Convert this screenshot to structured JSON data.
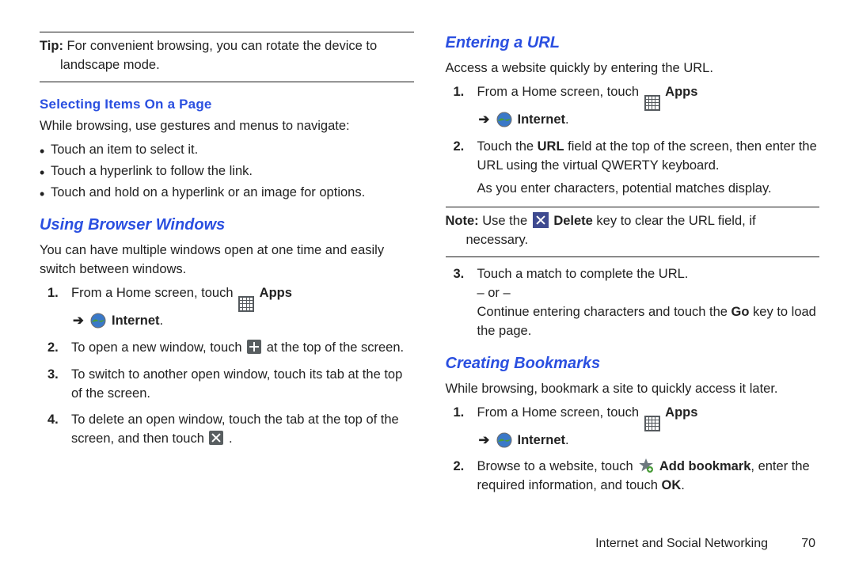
{
  "left": {
    "tip_label": "Tip:",
    "tip_lead": " For convenient browsing, you can rotate the device to",
    "tip_cont": "landscape mode.",
    "sub1": "Selecting Items On a Page",
    "sub1_intro": "While browsing, use gestures and menus to navigate:",
    "bullets": [
      "Touch an item to select it.",
      "Touch a hyperlink to follow the link.",
      "Touch and hold on a hyperlink or an image for options."
    ],
    "sec1": "Using Browser Windows",
    "sec1_intro": "You can have multiple windows open at one time and easily switch between windows.",
    "steps": {
      "s1_a": "From a Home screen, touch ",
      "s1_apps": " Apps",
      "s1_arrow": "➔",
      "s1_internet": " Internet",
      "s1_end": ".",
      "s2_a": "To open a new window, touch ",
      "s2_b": " at the top of the screen.",
      "s3": "To switch to another open window, touch its tab at the top of the screen.",
      "s4_a": "To delete an open window, touch the tab at the top of the screen, and then touch ",
      "s4_b": " ."
    }
  },
  "right": {
    "sec1": "Entering a URL",
    "sec1_intro": "Access a website quickly by entering the URL.",
    "steps1": {
      "s1_a": "From a Home screen, touch ",
      "s1_apps": " Apps",
      "s1_arrow": "➔",
      "s1_internet": " Internet",
      "s1_end": ".",
      "s2_a": "Touch the ",
      "s2_url": "URL",
      "s2_b": " field at the top of the screen, then enter the URL using the virtual QWERTY keyboard.",
      "s2_c": "As you enter characters, potential matches display."
    },
    "note_label": "Note:",
    "note_a": " Use the ",
    "note_del": " Delete",
    "note_b": " key to clear the URL field, if",
    "note_cont": "necessary.",
    "steps2": {
      "s3_a": "Touch a match to complete the URL.",
      "s3_or": "– or –",
      "s3_b_a": "Continue entering characters and touch the ",
      "s3_go": "Go",
      "s3_b_b": " key to load the page."
    },
    "sec2": "Creating Bookmarks",
    "sec2_intro": "While browsing, bookmark a site to quickly access it later.",
    "steps3": {
      "s1_a": "From a Home screen, touch ",
      "s1_apps": " Apps",
      "s1_arrow": "➔",
      "s1_internet": " Internet",
      "s1_end": ".",
      "s2_a": "Browse to a website, touch ",
      "s2_addbm": " Add bookmark",
      "s2_b": ", enter the required information, and touch ",
      "s2_ok": "OK",
      "s2_c": "."
    }
  },
  "footer": {
    "title": "Internet and Social Networking",
    "page": "70"
  }
}
